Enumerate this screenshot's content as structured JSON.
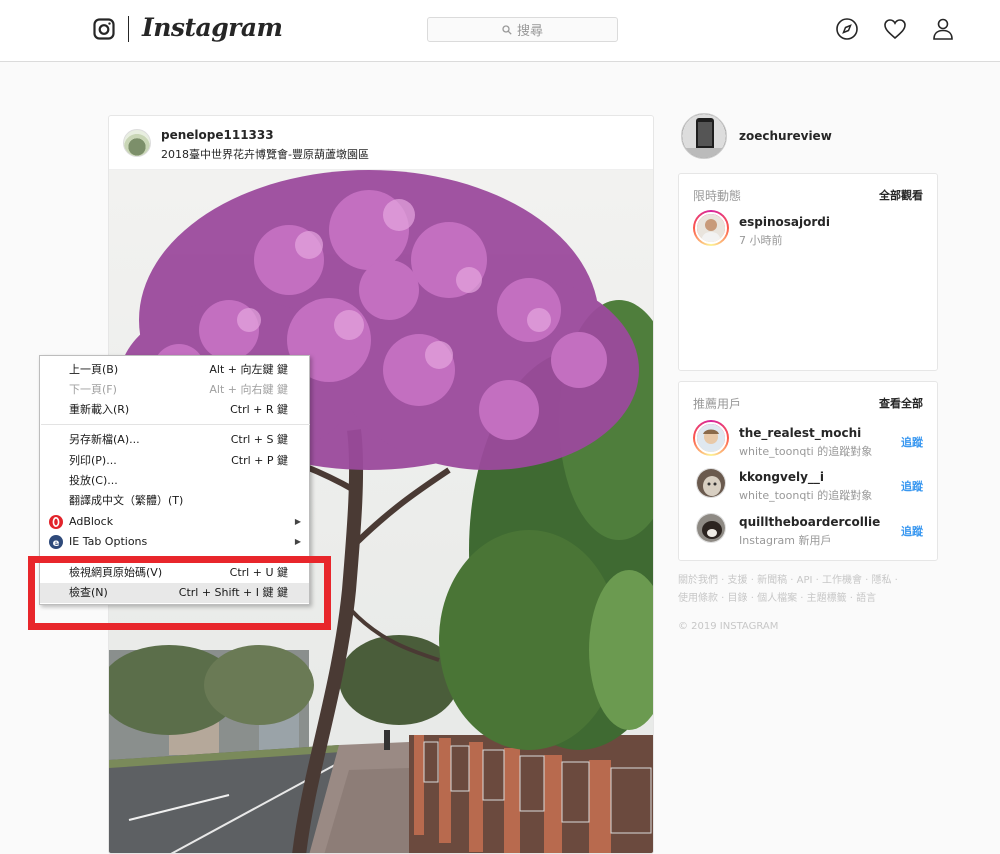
{
  "header": {
    "wordmark": "Instagram",
    "search_placeholder": "搜尋",
    "icons": [
      "instagram-glyph-icon",
      "compass-icon",
      "heart-icon",
      "profile-icon"
    ]
  },
  "post": {
    "username": "penelope111333",
    "location": "2018臺中世界花卉博覽會-豐原葫蘆墩園區"
  },
  "sidebar": {
    "me": {
      "username": "zoechureview"
    },
    "stories": {
      "title": "限時動態",
      "action": "全部觀看",
      "items": [
        {
          "username": "espinosajordi",
          "time": "7 小時前"
        }
      ]
    },
    "suggestions": {
      "title": "推薦用戶",
      "action": "查看全部",
      "follow_label": "追蹤",
      "items": [
        {
          "username": "the_realest_mochi",
          "note": "white_toonqti 的追蹤對象"
        },
        {
          "username": "kkongvely__i",
          "note": "white_toonqti 的追蹤對象"
        },
        {
          "username": "quilltheboardercollie",
          "note": "Instagram 新用戶"
        }
      ]
    },
    "footer": {
      "links_line1": "關於我們 · 支援 · 新聞稿 · API · 工作機會 · 隱私 ·",
      "links_line2": "使用條款 · 目錄 · 個人檔案 · 主題標籤 · 語言",
      "copyright": "© 2019 INSTAGRAM"
    }
  },
  "context_menu": {
    "items": [
      {
        "label": "上一頁(B)",
        "shortcut": "Alt + 向左鍵 鍵"
      },
      {
        "label": "下一頁(F)",
        "shortcut": "Alt + 向右鍵 鍵",
        "disabled": true
      },
      {
        "label": "重新載入(R)",
        "shortcut": "Ctrl + R 鍵"
      },
      {
        "label": "另存新檔(A)...",
        "shortcut": "Ctrl + S 鍵"
      },
      {
        "label": "列印(P)...",
        "shortcut": "Ctrl + P 鍵"
      },
      {
        "label": "投放(C)...",
        "shortcut": ""
      },
      {
        "label": "翻譯成中文（繁體）(T)",
        "shortcut": ""
      },
      {
        "label": "AdBlock",
        "shortcut": ""
      },
      {
        "label": "IE Tab Options",
        "shortcut": ""
      },
      {
        "label": "檢視網頁原始碼(V)",
        "shortcut": "Ctrl + U 鍵"
      },
      {
        "label": "檢查(N)",
        "shortcut": "Ctrl + Shift + I 鍵 鍵"
      }
    ],
    "highlight_color": "#e8262b"
  }
}
